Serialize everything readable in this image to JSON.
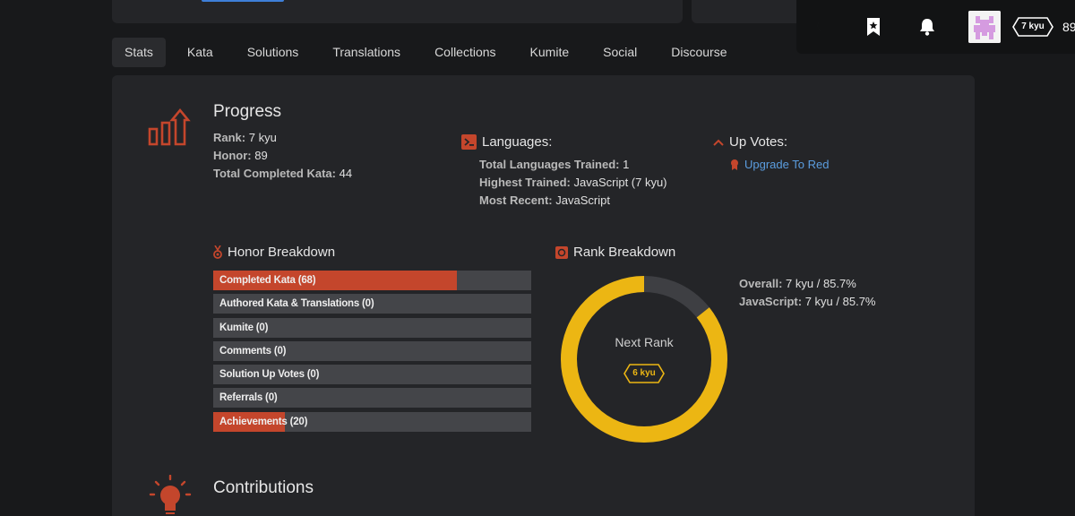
{
  "topbar": {
    "icons": [
      "moon-icon",
      "bookmark-icon",
      "bell-icon"
    ],
    "rank_badge": "7 kyu",
    "honor": "89"
  },
  "tabs": [
    {
      "label": "Stats",
      "active": true
    },
    {
      "label": "Kata"
    },
    {
      "label": "Solutions"
    },
    {
      "label": "Translations"
    },
    {
      "label": "Collections"
    },
    {
      "label": "Kumite"
    },
    {
      "label": "Social"
    },
    {
      "label": "Discourse"
    }
  ],
  "progress": {
    "title": "Progress",
    "rank_label": "Rank:",
    "rank_value": "7 kyu",
    "honor_label": "Honor:",
    "honor_value": "89",
    "completed_label": "Total Completed Kata:",
    "completed_value": "44"
  },
  "languages": {
    "title": "Languages:",
    "trained_label": "Total Languages Trained:",
    "trained_value": "1",
    "highest_label": "Highest Trained:",
    "highest_value": "JavaScript (7 kyu)",
    "recent_label": "Most Recent:",
    "recent_value": "JavaScript"
  },
  "upvotes": {
    "title": "Up Votes:",
    "link": "Upgrade To Red"
  },
  "honor_breakdown": {
    "title": "Honor Breakdown",
    "items": [
      {
        "label": "Completed Kata (68)",
        "fraction": 0.765
      },
      {
        "label": "Authored Kata & Translations (0)",
        "fraction": 0
      },
      {
        "label": "Kumite (0)",
        "fraction": 0
      },
      {
        "label": "Comments (0)",
        "fraction": 0
      },
      {
        "label": "Solution Up Votes (0)",
        "fraction": 0
      },
      {
        "label": "Referrals (0)",
        "fraction": 0
      },
      {
        "label": "Achievements (20)",
        "fraction": 0.225
      }
    ]
  },
  "rank_breakdown": {
    "title": "Rank Breakdown",
    "progress_fraction": 0.857,
    "next_rank_label": "Next Rank",
    "next_rank_badge": "6 kyu",
    "overall_label": "Overall:",
    "overall_value": "7 kyu / 85.7%",
    "js_label": "JavaScript:",
    "js_value": "7 kyu / 85.7%"
  },
  "contributions": {
    "title": "Contributions"
  },
  "colors": {
    "accent_red": "#c4462c",
    "rank_yellow": "#ecb613",
    "link_blue": "#5b9ddf"
  }
}
